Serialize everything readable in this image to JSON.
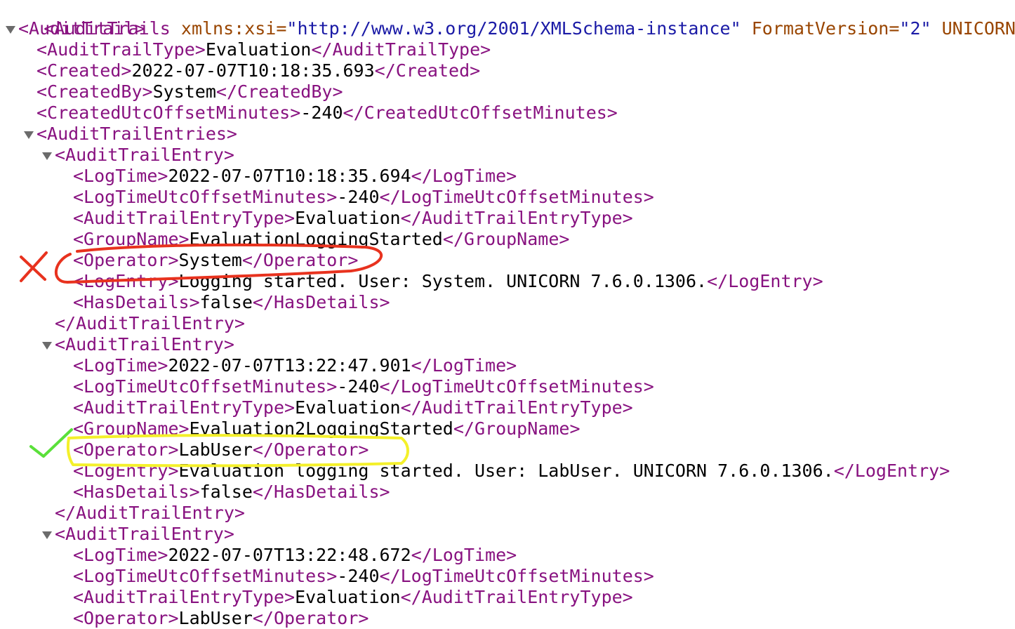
{
  "root": {
    "open_tag": "<AuditTrails",
    "attr1_name": " xmlns:xsi=",
    "attr1_value": "\"http://www.w3.org/2001/XMLSchema-instance\"",
    "attr2_name": " FormatVersion=",
    "attr2_value": "\"2\"",
    "trailing": " UNICORN"
  },
  "lines": [
    {
      "indent": 1,
      "toggle": true,
      "open": "<AuditTrail>"
    },
    {
      "indent": 2,
      "open": "<AuditTrailType>",
      "text": "Evaluation",
      "close": "</AuditTrailType>"
    },
    {
      "indent": 2,
      "open": "<Created>",
      "text": "2022-07-07T10:18:35.693",
      "close": "</Created>"
    },
    {
      "indent": 2,
      "open": "<CreatedBy>",
      "text": "System",
      "close": "</CreatedBy>"
    },
    {
      "indent": 2,
      "open": "<CreatedUtcOffsetMinutes>",
      "text": "-240",
      "close": "</CreatedUtcOffsetMinutes>"
    },
    {
      "indent": 2,
      "toggle": true,
      "open": "<AuditTrailEntries>"
    },
    {
      "indent": 3,
      "toggle": true,
      "open": "<AuditTrailEntry>"
    },
    {
      "indent": 4,
      "open": "<LogTime>",
      "text": "2022-07-07T10:18:35.694",
      "close": "</LogTime>"
    },
    {
      "indent": 4,
      "open": "<LogTimeUtcOffsetMinutes>",
      "text": "-240",
      "close": "</LogTimeUtcOffsetMinutes>"
    },
    {
      "indent": 4,
      "open": "<AuditTrailEntryType>",
      "text": "Evaluation",
      "close": "</AuditTrailEntryType>"
    },
    {
      "indent": 4,
      "open": "<GroupName>",
      "text": "EvaluationLoggingStarted",
      "close": "</GroupName>"
    },
    {
      "indent": 4,
      "open": "<Operator>",
      "text": "System",
      "close": "</Operator>"
    },
    {
      "indent": 4,
      "open": "<LogEntry>",
      "text": "Logging started. User: System. UNICORN 7.6.0.1306.",
      "close": "</LogEntry>"
    },
    {
      "indent": 4,
      "open": "<HasDetails>",
      "text": "false",
      "close": "</HasDetails>"
    },
    {
      "indent": 3,
      "close": "</AuditTrailEntry>"
    },
    {
      "indent": 3,
      "toggle": true,
      "open": "<AuditTrailEntry>"
    },
    {
      "indent": 4,
      "open": "<LogTime>",
      "text": "2022-07-07T13:22:47.901",
      "close": "</LogTime>"
    },
    {
      "indent": 4,
      "open": "<LogTimeUtcOffsetMinutes>",
      "text": "-240",
      "close": "</LogTimeUtcOffsetMinutes>"
    },
    {
      "indent": 4,
      "open": "<AuditTrailEntryType>",
      "text": "Evaluation",
      "close": "</AuditTrailEntryType>"
    },
    {
      "indent": 4,
      "open": "<GroupName>",
      "text": "Evaluation2LoggingStarted",
      "close": "</GroupName>"
    },
    {
      "indent": 4,
      "open": "<Operator>",
      "text": "LabUser",
      "close": "</Operator>"
    },
    {
      "indent": 4,
      "open": "<LogEntry>",
      "text": "Evaluation logging started. User: LabUser. UNICORN 7.6.0.1306.",
      "close": "</LogEntry>"
    },
    {
      "indent": 4,
      "open": "<HasDetails>",
      "text": "false",
      "close": "</HasDetails>"
    },
    {
      "indent": 3,
      "close": "</AuditTrailEntry>"
    },
    {
      "indent": 3,
      "toggle": true,
      "open": "<AuditTrailEntry>"
    },
    {
      "indent": 4,
      "open": "<LogTime>",
      "text": "2022-07-07T13:22:48.672",
      "close": "</LogTime>"
    },
    {
      "indent": 4,
      "open": "<LogTimeUtcOffsetMinutes>",
      "text": "-240",
      "close": "</LogTimeUtcOffsetMinutes>"
    },
    {
      "indent": 4,
      "open": "<AuditTrailEntryType>",
      "text": "Evaluation",
      "close": "</AuditTrailEntryType>"
    },
    {
      "indent": 4,
      "open": "<Operator>",
      "text": "LabUser",
      "close": "</Operator>"
    }
  ],
  "colors": {
    "tag": "#881280",
    "attribute_name": "#994500",
    "attribute_value": "#1a1aa6",
    "text": "#000000",
    "toggle_triangle": "#6b6b6b",
    "annotation_red": "#e8321e",
    "annotation_yellow": "#f4f02a",
    "annotation_green": "#5ae03a"
  },
  "annotations": [
    {
      "name": "red-x-mark",
      "line": 11
    },
    {
      "name": "red-circle-operator-system",
      "line": 11
    },
    {
      "name": "yellow-circle-operator-labuser",
      "line": 20
    },
    {
      "name": "green-check-mark",
      "line": 20
    }
  ]
}
